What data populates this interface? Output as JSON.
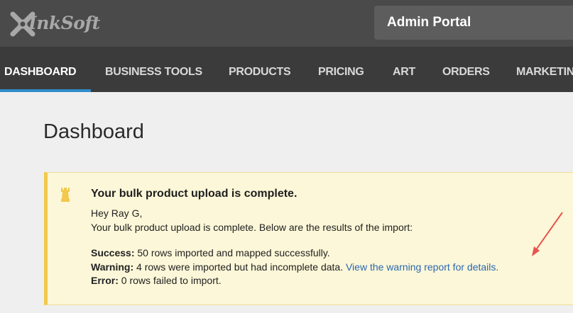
{
  "header": {
    "logo_text": "InkSoft",
    "portal_title": "Admin Portal"
  },
  "nav": {
    "items": [
      {
        "label": "DASHBOARD",
        "active": true
      },
      {
        "label": "BUSINESS TOOLS",
        "active": false
      },
      {
        "label": "PRODUCTS",
        "active": false
      },
      {
        "label": "PRICING",
        "active": false
      },
      {
        "label": "ART",
        "active": false
      },
      {
        "label": "ORDERS",
        "active": false
      },
      {
        "label": "MARKETING",
        "active": false
      }
    ]
  },
  "main": {
    "page_title": "Dashboard",
    "alert": {
      "icon": "chess-rook-icon",
      "title": "Your bulk product upload is complete.",
      "greeting": "Hey Ray G,",
      "message": "Your bulk product upload is complete. Below are the results of the import:",
      "success_label": "Success:",
      "success_text": " 50 rows imported and mapped successfully.",
      "warning_label": "Warning:",
      "warning_text": " 4 rows were imported but had incomplete data. ",
      "warning_link": "View the warning report for details.",
      "error_label": "Error:",
      "error_text": " 0 rows failed to import."
    }
  },
  "colors": {
    "topbar": "#4a4a4a",
    "navbar": "#3b3b3b",
    "active_underline": "#2f8ccc",
    "alert_bg": "#fcf7d8",
    "alert_accent": "#f2c94c",
    "link": "#2a67b1",
    "annotation_arrow": "#e8554e"
  }
}
